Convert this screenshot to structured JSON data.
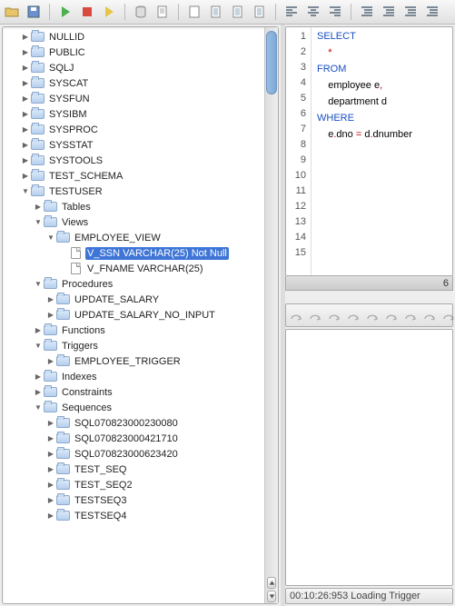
{
  "toolbar": {
    "icons": [
      "open",
      "save",
      "sep",
      "run-green",
      "stop-red",
      "run-yellow",
      "sep",
      "db",
      "script",
      "sep",
      "book",
      "copy-sheet",
      "sheet-pencil",
      "sheet",
      "sep",
      "align-left",
      "align-center",
      "align-right",
      "sep",
      "indent-left",
      "outdent",
      "indent-right",
      "format"
    ]
  },
  "tree": [
    {
      "d": 2,
      "t": "closed",
      "i": "folder",
      "l": "NULLID"
    },
    {
      "d": 2,
      "t": "closed",
      "i": "folder",
      "l": "PUBLIC"
    },
    {
      "d": 2,
      "t": "closed",
      "i": "folder",
      "l": "SQLJ"
    },
    {
      "d": 2,
      "t": "closed",
      "i": "folder",
      "l": "SYSCAT"
    },
    {
      "d": 2,
      "t": "closed",
      "i": "folder",
      "l": "SYSFUN"
    },
    {
      "d": 2,
      "t": "closed",
      "i": "folder",
      "l": "SYSIBM"
    },
    {
      "d": 2,
      "t": "closed",
      "i": "folder",
      "l": "SYSPROC"
    },
    {
      "d": 2,
      "t": "closed",
      "i": "folder",
      "l": "SYSSTAT"
    },
    {
      "d": 2,
      "t": "closed",
      "i": "folder",
      "l": "SYSTOOLS"
    },
    {
      "d": 2,
      "t": "closed",
      "i": "folder",
      "l": "TEST_SCHEMA"
    },
    {
      "d": 2,
      "t": "open",
      "i": "folder",
      "l": "TESTUSER"
    },
    {
      "d": 3,
      "t": "closed",
      "i": "folder",
      "l": "Tables"
    },
    {
      "d": 3,
      "t": "open",
      "i": "folder",
      "l": "Views"
    },
    {
      "d": 4,
      "t": "open",
      "i": "folder",
      "l": "EMPLOYEE_VIEW"
    },
    {
      "d": 5,
      "t": "none",
      "i": "file",
      "l": "V_SSN VARCHAR(25) Not Null",
      "sel": true
    },
    {
      "d": 5,
      "t": "none",
      "i": "file",
      "l": "V_FNAME VARCHAR(25)"
    },
    {
      "d": 3,
      "t": "open",
      "i": "folder",
      "l": "Procedures"
    },
    {
      "d": 4,
      "t": "closed",
      "i": "folder",
      "l": "UPDATE_SALARY"
    },
    {
      "d": 4,
      "t": "closed",
      "i": "folder",
      "l": "UPDATE_SALARY_NO_INPUT"
    },
    {
      "d": 3,
      "t": "closed",
      "i": "folder",
      "l": "Functions"
    },
    {
      "d": 3,
      "t": "open",
      "i": "folder",
      "l": "Triggers"
    },
    {
      "d": 4,
      "t": "closed",
      "i": "folder",
      "l": "EMPLOYEE_TRIGGER"
    },
    {
      "d": 3,
      "t": "closed",
      "i": "folder",
      "l": "Indexes"
    },
    {
      "d": 3,
      "t": "closed",
      "i": "folder",
      "l": "Constraints"
    },
    {
      "d": 3,
      "t": "open",
      "i": "folder",
      "l": "Sequences"
    },
    {
      "d": 4,
      "t": "closed",
      "i": "folder",
      "l": "SQL070823000230080"
    },
    {
      "d": 4,
      "t": "closed",
      "i": "folder",
      "l": "SQL070823000421710"
    },
    {
      "d": 4,
      "t": "closed",
      "i": "folder",
      "l": "SQL070823000623420"
    },
    {
      "d": 4,
      "t": "closed",
      "i": "folder",
      "l": "TEST_SEQ"
    },
    {
      "d": 4,
      "t": "closed",
      "i": "folder",
      "l": "TEST_SEQ2"
    },
    {
      "d": 4,
      "t": "closed",
      "i": "folder",
      "l": "TESTSEQ3"
    },
    {
      "d": 4,
      "t": "closed",
      "i": "folder",
      "l": "TESTSEQ4"
    }
  ],
  "editor": {
    "line_count": 15,
    "current_line": 8,
    "tokens": [
      [
        {
          "t": "SELECT",
          "c": "kw"
        }
      ],
      [
        {
          "t": "    ",
          "c": ""
        },
        {
          "t": "*",
          "c": "op"
        }
      ],
      [
        {
          "t": "FROM",
          "c": "kw"
        }
      ],
      [
        {
          "t": "    employee e",
          "c": ""
        },
        {
          "t": ",",
          "c": "op"
        }
      ],
      [
        {
          "t": "    department d",
          "c": ""
        }
      ],
      [
        {
          "t": "WHERE",
          "c": "kw"
        }
      ],
      [
        {
          "t": "    e",
          "c": ""
        },
        {
          "t": ".",
          "c": "op"
        },
        {
          "t": "dno ",
          "c": ""
        },
        {
          "t": "=",
          "c": "op"
        },
        {
          "t": " d",
          "c": ""
        },
        {
          "t": ".",
          "c": "op"
        },
        {
          "t": "dnumber",
          "c": ""
        }
      ],
      [],
      [],
      [],
      [],
      [],
      [],
      [],
      []
    ],
    "hscroll_right": "6"
  },
  "mid_toolbar": [
    "step-over",
    "step-into",
    "thread",
    "step-out",
    "step-back",
    "undo",
    "pencil",
    "copy",
    "refresh"
  ],
  "status": {
    "text": "00:10:26:953 Loading Trigger"
  }
}
